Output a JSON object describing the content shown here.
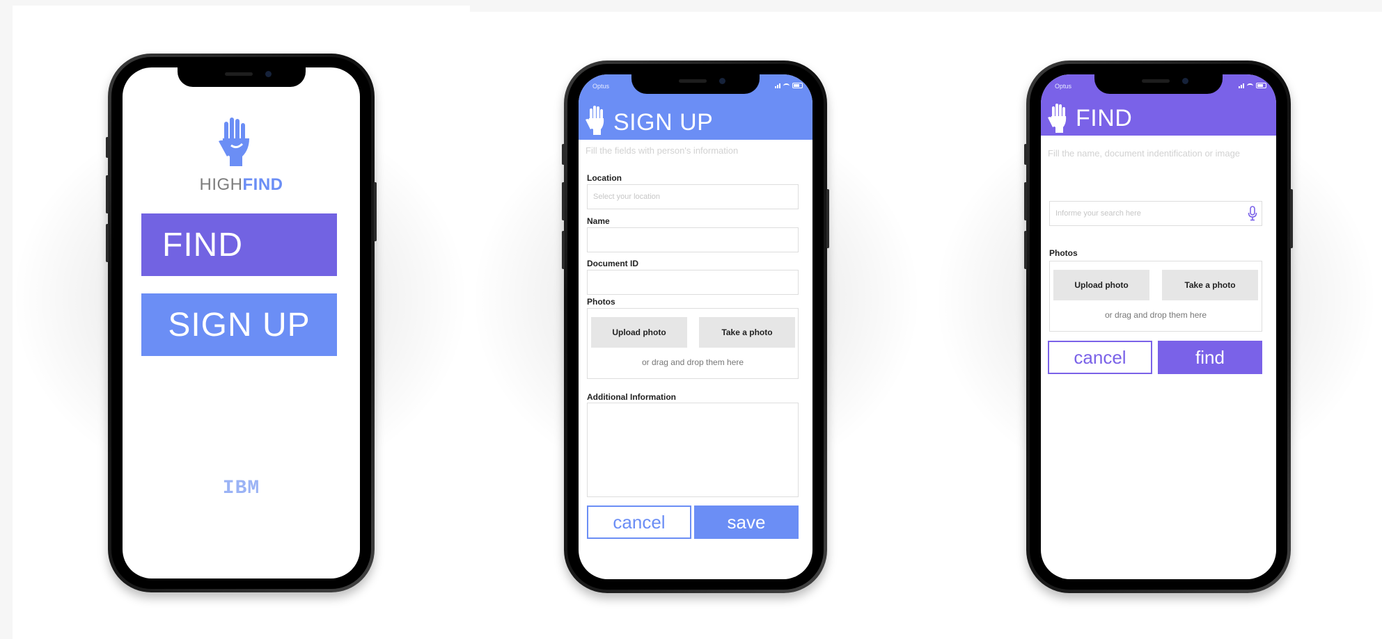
{
  "colors": {
    "find_purple": "#7263e2",
    "signup_blue": "#6b8ef5",
    "find_header": "#7a62e8",
    "signup_header": "#6b8ef5"
  },
  "screen_home": {
    "logo_icon": "hand-icon",
    "brand_light": "HIGH",
    "brand_bold": "FIND",
    "find_button": "FIND",
    "signup_button": "SIGN UP",
    "footer_logo": "IBM"
  },
  "screen_signup": {
    "carrier": "Optus",
    "header_icon": "hand-icon",
    "title": "SIGN UP",
    "hint": "Fill the fields with person's information",
    "location_label": "Location",
    "location_placeholder": "Select your location",
    "name_label": "Name",
    "document_label": "Document ID",
    "photos_label": "Photos",
    "upload_button": "Upload photo",
    "take_button": "Take a photo",
    "drag_hint": "or drag and drop them here",
    "additional_label": "Additional Information",
    "cancel_button": "cancel",
    "save_button": "save"
  },
  "screen_find": {
    "carrier": "Optus",
    "header_icon": "hand-icon",
    "title": "FIND",
    "hint": "Fill the name, document indentification or image",
    "search_placeholder": "Informe your search here",
    "mic_icon": "microphone-icon",
    "photos_label": "Photos",
    "upload_button": "Upload photo",
    "take_button": "Take a photo",
    "drag_hint": "or drag and drop them here",
    "cancel_button": "cancel",
    "find_button": "find"
  }
}
